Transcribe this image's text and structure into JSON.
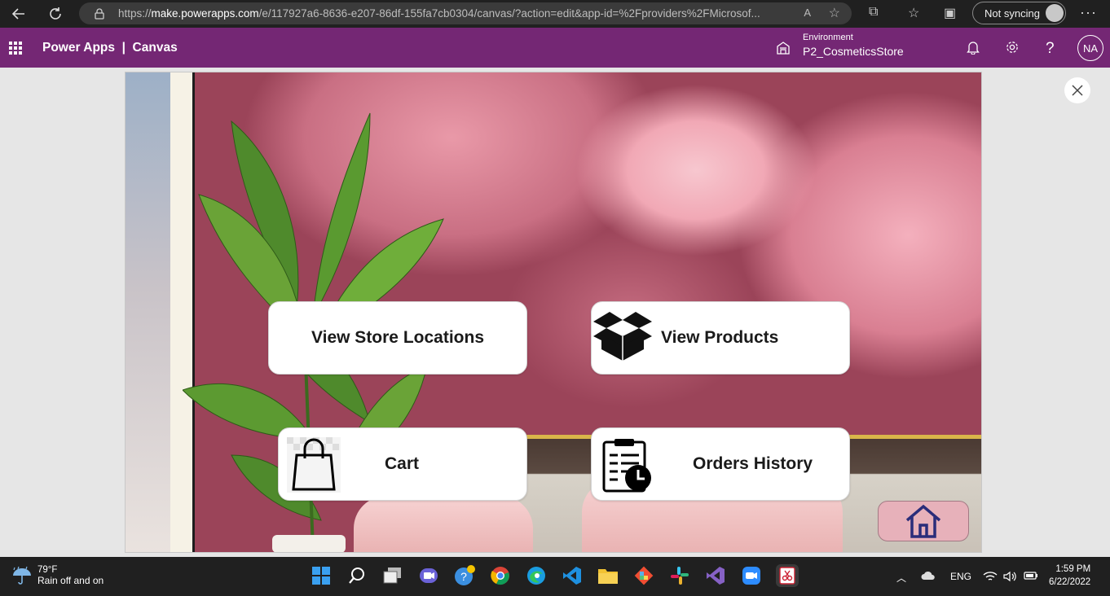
{
  "browser": {
    "url_prefix": "https://",
    "url_host": "make.powerapps.com",
    "url_path": "/e/117927a6-8636-e207-86df-155fa7cb0304/canvas/?action=edit&app-id=%2Fproviders%2FMicrosof...",
    "read_aloud": "A",
    "sync_label": "Not syncing"
  },
  "header": {
    "title": "Power Apps  |  Canvas",
    "env_label": "Environment",
    "env_name": "P2_CosmeticsStore",
    "user_initials": "NA",
    "help": "?",
    "brand_color": "#742774"
  },
  "app": {
    "buttons": [
      {
        "label": "View Store Locations",
        "icon": "none"
      },
      {
        "label": "View Products",
        "icon": "open-box-icon"
      },
      {
        "label": "Cart",
        "icon": "shopping-bag-icon"
      },
      {
        "label": "Orders History",
        "icon": "clipboard-clock-icon"
      }
    ],
    "home_icon": "home-icon",
    "home_color": "#e7b1ba",
    "home_icon_color": "#2a2d7a"
  },
  "taskbar": {
    "temp": "79°F",
    "weather": "Rain off and on",
    "lang": "ENG",
    "time": "1:59 PM",
    "date": "6/22/2022"
  }
}
